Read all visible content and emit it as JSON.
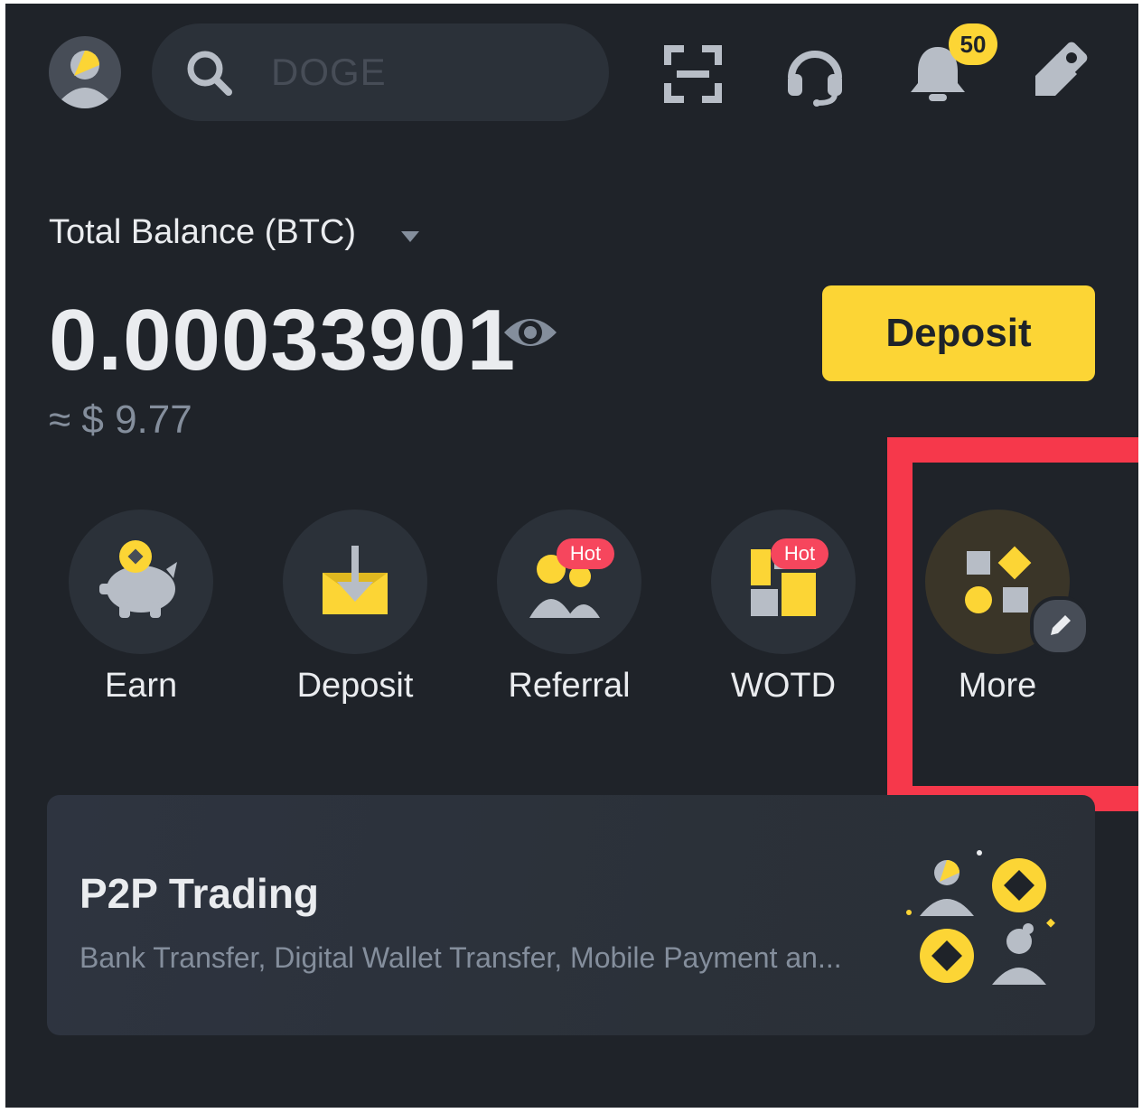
{
  "header": {
    "search": {
      "placeholder": "DOGE"
    },
    "notifications": {
      "count": "50"
    }
  },
  "balance": {
    "label": "Total Balance (BTC)",
    "value": "0.00033901",
    "fiat": "≈ $ 9.77",
    "deposit_label": "Deposit"
  },
  "shortcuts": [
    {
      "label": "Earn",
      "icon": "piggy-bank-icon"
    },
    {
      "label": "Deposit",
      "icon": "deposit-tray-icon"
    },
    {
      "label": "Referral",
      "icon": "referral-people-icon",
      "badge": "Hot"
    },
    {
      "label": "WOTD",
      "icon": "word-grid-icon",
      "badge": "Hot"
    },
    {
      "label": "More",
      "icon": "shapes-more-icon"
    }
  ],
  "p2p": {
    "title": "P2P Trading",
    "subtitle": "Bank Transfer, Digital Wallet Transfer, Mobile Payment an..."
  },
  "colors": {
    "background": "#1f2329",
    "accent": "#fcd535",
    "hot": "#f6465d",
    "highlight": "#f6384b"
  }
}
